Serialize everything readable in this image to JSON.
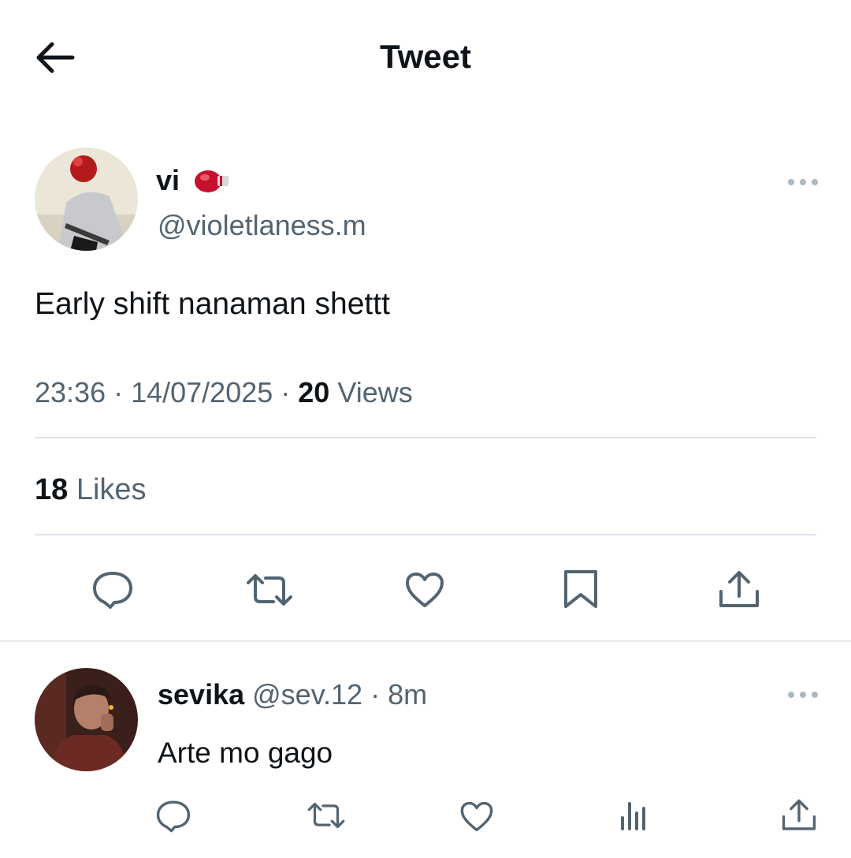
{
  "header": {
    "title": "Tweet"
  },
  "tweet": {
    "author_name": "vi",
    "author_badge": "boxing-glove-emoji",
    "author_handle": "@violetlaness.m",
    "text": "Early shift nanaman shettt",
    "time": "23:36",
    "date": "14/07/2025",
    "views_count": "20",
    "views_label": "Views",
    "likes_count": "18",
    "likes_label": "Likes",
    "actions": [
      "reply-icon",
      "retweet-icon",
      "like-icon",
      "bookmark-icon",
      "share-icon"
    ]
  },
  "reply": {
    "author_name": "sevika",
    "author_handle": "@sev.12",
    "time_ago": "8m",
    "text": "Arte mo gago",
    "actions": [
      "reply-icon",
      "retweet-icon",
      "like-icon",
      "views-icon",
      "share-icon"
    ]
  },
  "colors": {
    "text": "#0f1419",
    "secondary": "#536471",
    "icon": "#536471",
    "divider": "#dbe3ea"
  }
}
